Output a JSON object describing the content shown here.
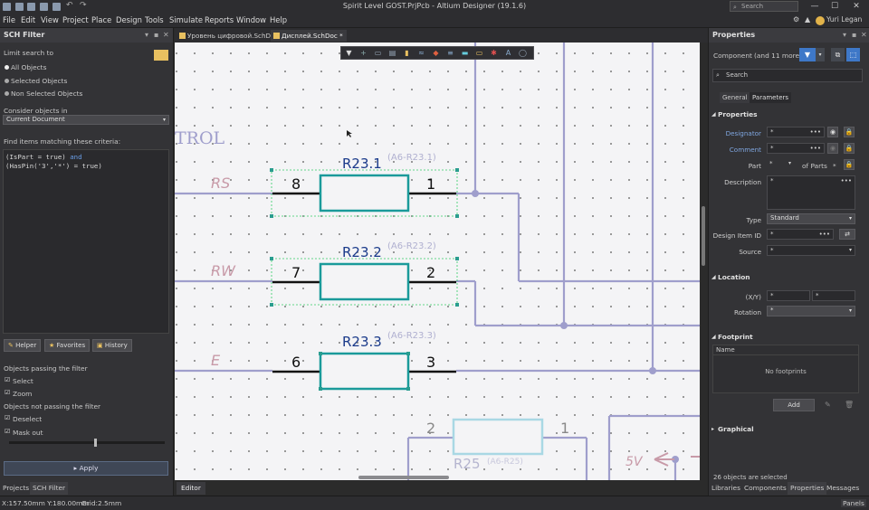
{
  "window": {
    "title": "Spirit Level GOST.PrjPcb - Altium Designer (19.1.6)",
    "search_placeholder": "Search",
    "user": "Yuri Legan",
    "min": "—",
    "max": "☐",
    "close": "✕"
  },
  "menu": [
    "File",
    "Edit",
    "View",
    "Project",
    "Place",
    "Design",
    "Tools",
    "Simulate",
    "Reports",
    "Window",
    "Help"
  ],
  "left_panel": {
    "title": "SCH Filter",
    "limit_label": "Limit search to",
    "radio_options": [
      "All Objects",
      "Selected Objects",
      "Non Selected Objects"
    ],
    "consider_label": "Consider objects in",
    "consider_value": "Current Document",
    "criteria_label": "Find items matching these criteria:",
    "query_line1_a": "(IsPart = true)",
    "query_line1_kw": "and",
    "query_line2": "(HasPin('3','*') = true)",
    "buttons": [
      "Helper",
      "Favorites",
      "History"
    ],
    "passing_label": "Objects passing the filter",
    "passing_options": [
      "Select",
      "Zoom"
    ],
    "not_passing_label": "Objects not passing the filter",
    "not_passing_options": [
      "Deselect",
      "Mask out"
    ],
    "apply": "Apply",
    "bottom_tabs": [
      "Projects",
      "SCH Filter"
    ]
  },
  "doc_tabs": [
    {
      "label": "Уровень цифровой.SchDoc"
    },
    {
      "label": "Дисплей.SchDoc *"
    }
  ],
  "editor_tab": "Editor",
  "schematic": {
    "title_fragment": "TROL",
    "nets": [
      "RS",
      "RW",
      "E"
    ],
    "supply": "5V",
    "resistors": [
      {
        "designator": "R23.1",
        "comment": "(A6-R23.1)",
        "pin_left": "8",
        "pin_right": "1"
      },
      {
        "designator": "R23.2",
        "comment": "(A6-R23.2)",
        "pin_left": "7",
        "pin_right": "2"
      },
      {
        "designator": "R23.3",
        "comment": "(A6-R23.3)",
        "pin_left": "6",
        "pin_right": "3"
      },
      {
        "designator": "R25",
        "comment": "(A6-R25)",
        "pin_left": "2",
        "pin_right": "1"
      }
    ]
  },
  "right_panel": {
    "title": "Properties",
    "component_label": "Component",
    "component_more": "(and 11 more)",
    "search_placeholder": "Search",
    "tabs": [
      "General",
      "Parameters"
    ],
    "sections": {
      "properties": "Properties",
      "location": "Location",
      "footprint": "Footprint",
      "graphical": "Graphical"
    },
    "fields": {
      "designator": {
        "label": "Designator",
        "value": "*"
      },
      "comment": {
        "label": "Comment",
        "value": "*"
      },
      "part": {
        "label": "Part",
        "value": "*",
        "of_parts": "of Parts",
        "of_value": "*"
      },
      "description": {
        "label": "Description",
        "value": "*"
      },
      "type": {
        "label": "Type",
        "value": "Standard"
      },
      "design_item": {
        "label": "Design Item ID",
        "value": "*"
      },
      "source": {
        "label": "Source",
        "value": "*"
      },
      "xy": {
        "label": "(X/Y)",
        "x": "*",
        "y": "*"
      },
      "rotation": {
        "label": "Rotation",
        "value": "*"
      }
    },
    "footprint_col": "Name",
    "no_footprints": "No footprints",
    "add": "Add",
    "selected_count": "26 objects are selected",
    "bottom_tabs": [
      "Libraries",
      "Components",
      "Properties",
      "Messages"
    ]
  },
  "status": {
    "coords": "X:157.50mm Y:180.00mm",
    "grid": "Grid:2.5mm",
    "panels": "Panels"
  },
  "colors": {
    "wire": "#9f9ecc",
    "body": "#1a9a9a",
    "body_dim": "#a9d8e4",
    "net": "#c89aa8",
    "highlight_blue": "#4a7fd0"
  }
}
